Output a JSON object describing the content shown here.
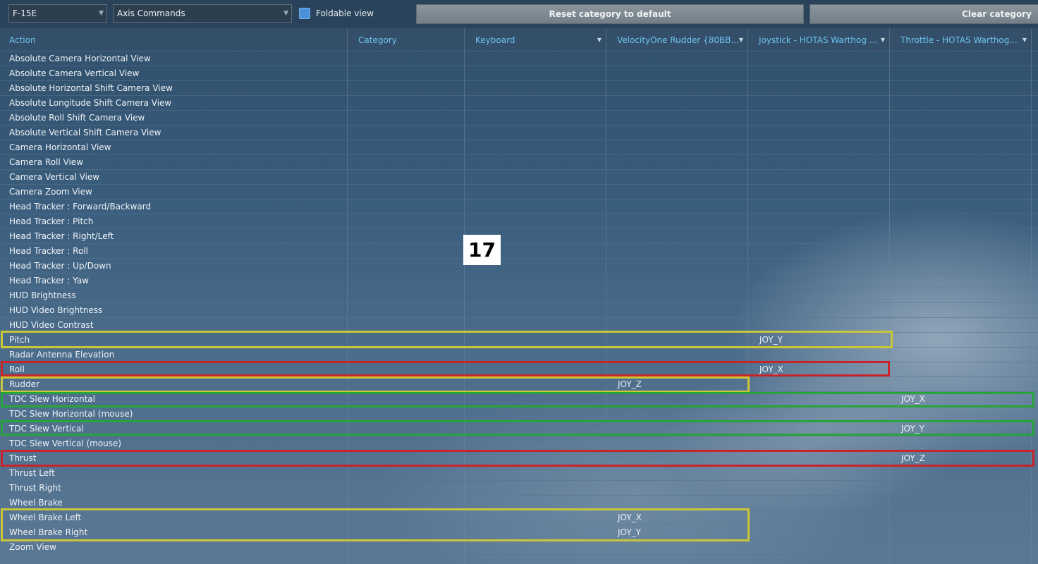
{
  "toolbar": {
    "aircraft_select": "F-15E",
    "category_select": "Axis Commands",
    "foldable_label": "Foldable view",
    "reset_button": "Reset category to default",
    "clear_button": "Clear category"
  },
  "columns": [
    "Action",
    "Category",
    "Keyboard",
    "VelocityOne Rudder {80BB...",
    "Joystick - HOTAS Warthog ...",
    "Throttle - HOTAS Warthog..."
  ],
  "rows": [
    {
      "action": "Absolute Camera Horizontal View",
      "rudder": "",
      "joystick": "",
      "throttle": ""
    },
    {
      "action": "Absolute Camera Vertical View",
      "rudder": "",
      "joystick": "",
      "throttle": ""
    },
    {
      "action": "Absolute Horizontal Shift Camera View",
      "rudder": "",
      "joystick": "",
      "throttle": ""
    },
    {
      "action": "Absolute Longitude Shift Camera View",
      "rudder": "",
      "joystick": "",
      "throttle": ""
    },
    {
      "action": "Absolute Roll Shift Camera View",
      "rudder": "",
      "joystick": "",
      "throttle": ""
    },
    {
      "action": "Absolute Vertical Shift Camera View",
      "rudder": "",
      "joystick": "",
      "throttle": ""
    },
    {
      "action": "Camera Horizontal View",
      "rudder": "",
      "joystick": "",
      "throttle": ""
    },
    {
      "action": "Camera Roll View",
      "rudder": "",
      "joystick": "",
      "throttle": ""
    },
    {
      "action": "Camera Vertical View",
      "rudder": "",
      "joystick": "",
      "throttle": ""
    },
    {
      "action": "Camera Zoom View",
      "rudder": "",
      "joystick": "",
      "throttle": ""
    },
    {
      "action": "Head Tracker : Forward/Backward",
      "rudder": "",
      "joystick": "",
      "throttle": ""
    },
    {
      "action": "Head Tracker : Pitch",
      "rudder": "",
      "joystick": "",
      "throttle": ""
    },
    {
      "action": "Head Tracker : Right/Left",
      "rudder": "",
      "joystick": "",
      "throttle": ""
    },
    {
      "action": "Head Tracker : Roll",
      "rudder": "",
      "joystick": "",
      "throttle": ""
    },
    {
      "action": "Head Tracker : Up/Down",
      "rudder": "",
      "joystick": "",
      "throttle": ""
    },
    {
      "action": "Head Tracker : Yaw",
      "rudder": "",
      "joystick": "",
      "throttle": ""
    },
    {
      "action": "HUD Brightness",
      "rudder": "",
      "joystick": "",
      "throttle": ""
    },
    {
      "action": "HUD Video Brightness",
      "rudder": "",
      "joystick": "",
      "throttle": ""
    },
    {
      "action": "HUD Video Contrast",
      "rudder": "",
      "joystick": "",
      "throttle": ""
    },
    {
      "action": "Pitch",
      "rudder": "",
      "joystick": "JOY_Y",
      "throttle": ""
    },
    {
      "action": "Radar Antenna Elevation",
      "rudder": "",
      "joystick": "",
      "throttle": ""
    },
    {
      "action": "Roll",
      "rudder": "",
      "joystick": "JOY_X",
      "throttle": ""
    },
    {
      "action": "Rudder",
      "rudder": "JOY_Z",
      "joystick": "",
      "throttle": ""
    },
    {
      "action": "TDC Slew Horizontal",
      "rudder": "",
      "joystick": "",
      "throttle": "JOY_X"
    },
    {
      "action": "TDC Slew Horizontal (mouse)",
      "rudder": "",
      "joystick": "",
      "throttle": ""
    },
    {
      "action": "TDC Slew Vertical",
      "rudder": "",
      "joystick": "",
      "throttle": "JOY_Y"
    },
    {
      "action": "TDC Slew Vertical (mouse)",
      "rudder": "",
      "joystick": "",
      "throttle": ""
    },
    {
      "action": "Thrust",
      "rudder": "",
      "joystick": "",
      "throttle": "JOY_Z"
    },
    {
      "action": "Thrust Left",
      "rudder": "",
      "joystick": "",
      "throttle": ""
    },
    {
      "action": "Thrust Right",
      "rudder": "",
      "joystick": "",
      "throttle": ""
    },
    {
      "action": "Wheel Brake",
      "rudder": "",
      "joystick": "",
      "throttle": ""
    },
    {
      "action": "Wheel Brake Left",
      "rudder": "JOY_X",
      "joystick": "",
      "throttle": ""
    },
    {
      "action": "Wheel Brake Right",
      "rudder": "JOY_Y",
      "joystick": "",
      "throttle": ""
    },
    {
      "action": "Zoom View",
      "rudder": "",
      "joystick": "",
      "throttle": ""
    }
  ],
  "annotation": "17",
  "colors": {
    "highlight_yellow": "#c9c63a",
    "highlight_red": "#c8242a",
    "highlight_green": "#27a43a",
    "header_text": "#6ec3f0"
  }
}
